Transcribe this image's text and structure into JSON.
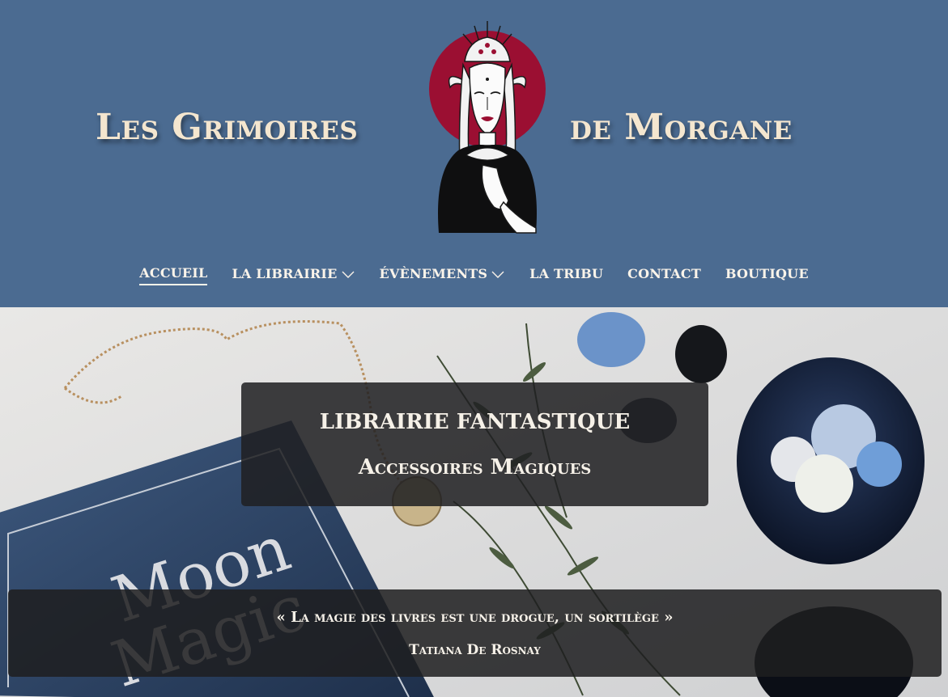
{
  "header": {
    "title_left": "Les Grimoires",
    "title_right": "de Morgane",
    "logo_icon": "witch-portrait-logo-icon"
  },
  "nav": {
    "items": [
      {
        "label": "ACCUEIL",
        "active": true,
        "has_dropdown": false
      },
      {
        "label": "LA LIBRAIRIE",
        "active": false,
        "has_dropdown": true
      },
      {
        "label": "ÉVÈNEMENTS",
        "active": false,
        "has_dropdown": true
      },
      {
        "label": "LA TRIBU",
        "active": false,
        "has_dropdown": false
      },
      {
        "label": "CONTACT",
        "active": false,
        "has_dropdown": false
      },
      {
        "label": "BOUTIQUE",
        "active": false,
        "has_dropdown": false
      }
    ]
  },
  "hero": {
    "tagline_1": "LIBRAIRIE FANTASTIQUE",
    "tagline_2": "Accessoires Magiques",
    "quote": "« La magie des livres est une drogue, un sortilège »",
    "author": "Tatiana De Rosnay",
    "book_title_on_image": "Moon Magic"
  },
  "colors": {
    "header_bg": "#4b6b91",
    "title": "#f4e6cf",
    "logo_circle": "#9b0f32",
    "nav_text": "#fbf4ea"
  }
}
